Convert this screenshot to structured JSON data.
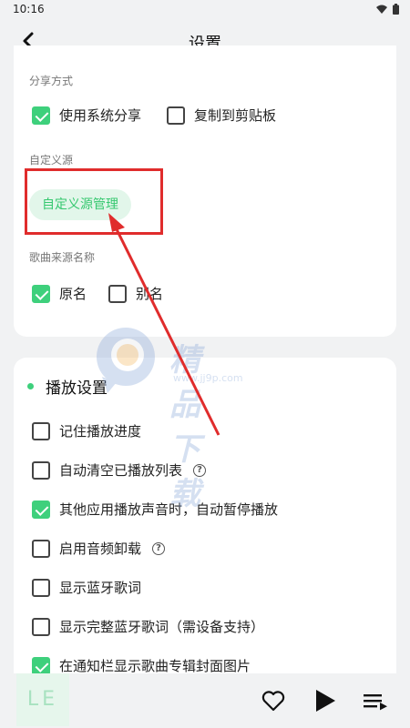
{
  "status": {
    "time": "10:16"
  },
  "header": {
    "title": "设置"
  },
  "share": {
    "section_label": "分享方式",
    "options": [
      {
        "label": "使用系统分享",
        "checked": true
      },
      {
        "label": "复制到剪贴板",
        "checked": false
      }
    ]
  },
  "custom_source": {
    "section_label": "自定义源",
    "button_label": "自定义源管理"
  },
  "song_source_name": {
    "section_label": "歌曲来源名称",
    "options": [
      {
        "label": "原名",
        "checked": true
      },
      {
        "label": "别名",
        "checked": false
      }
    ]
  },
  "play_settings": {
    "title": "播放设置",
    "items": [
      {
        "label": "记住播放进度",
        "checked": false,
        "help": false
      },
      {
        "label": "自动清空已播放列表",
        "checked": false,
        "help": true
      },
      {
        "label": "其他应用播放声音时，自动暂停播放",
        "checked": true,
        "help": false
      },
      {
        "label": "启用音频卸载",
        "checked": false,
        "help": true
      },
      {
        "label": "显示蓝牙歌词",
        "checked": false,
        "help": false
      },
      {
        "label": "显示完整蓝牙歌词（需设备支持）",
        "checked": false,
        "help": false
      },
      {
        "label": "在通知栏显示歌曲专辑封面图片",
        "checked": true,
        "help": false
      }
    ]
  },
  "watermark": {
    "text": "精品下载",
    "url": "www.jj9p.com"
  },
  "player": {
    "cover_text": "LE"
  },
  "colors": {
    "accent": "#3ed07c",
    "highlight_box": "#e02c2c"
  }
}
